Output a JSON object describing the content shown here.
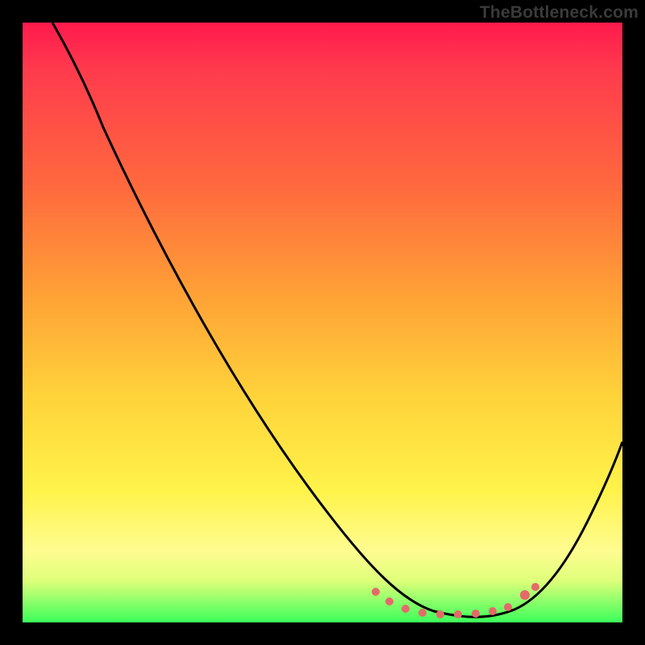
{
  "watermark": "TheBottleneck.com",
  "chart_data": {
    "type": "line",
    "title": "",
    "xlabel": "",
    "ylabel": "",
    "xlim": [
      0,
      100
    ],
    "ylim": [
      0,
      100
    ],
    "grid": false,
    "legend": false,
    "series": [
      {
        "name": "bottleneck-curve",
        "x": [
          5,
          12,
          20,
          28,
          36,
          44,
          52,
          58,
          62,
          66,
          70,
          74,
          78,
          82,
          86,
          92,
          100
        ],
        "values": [
          100,
          90,
          78,
          66,
          54,
          42,
          30,
          20,
          12,
          7,
          3,
          1,
          1,
          2,
          6,
          14,
          28
        ]
      }
    ],
    "trough_markers": {
      "name": "optimal-zone-dots",
      "x": [
        58,
        61,
        64,
        67,
        70,
        73,
        76,
        79,
        82
      ],
      "values": [
        4.5,
        3,
        2,
        1.5,
        1.2,
        1.2,
        1.5,
        2,
        3.5
      ]
    },
    "colors": {
      "curve": "#000000",
      "dots": "#e46a6a",
      "gradient_top": "#ff1a4d",
      "gradient_bottom": "#3bff5a"
    }
  }
}
